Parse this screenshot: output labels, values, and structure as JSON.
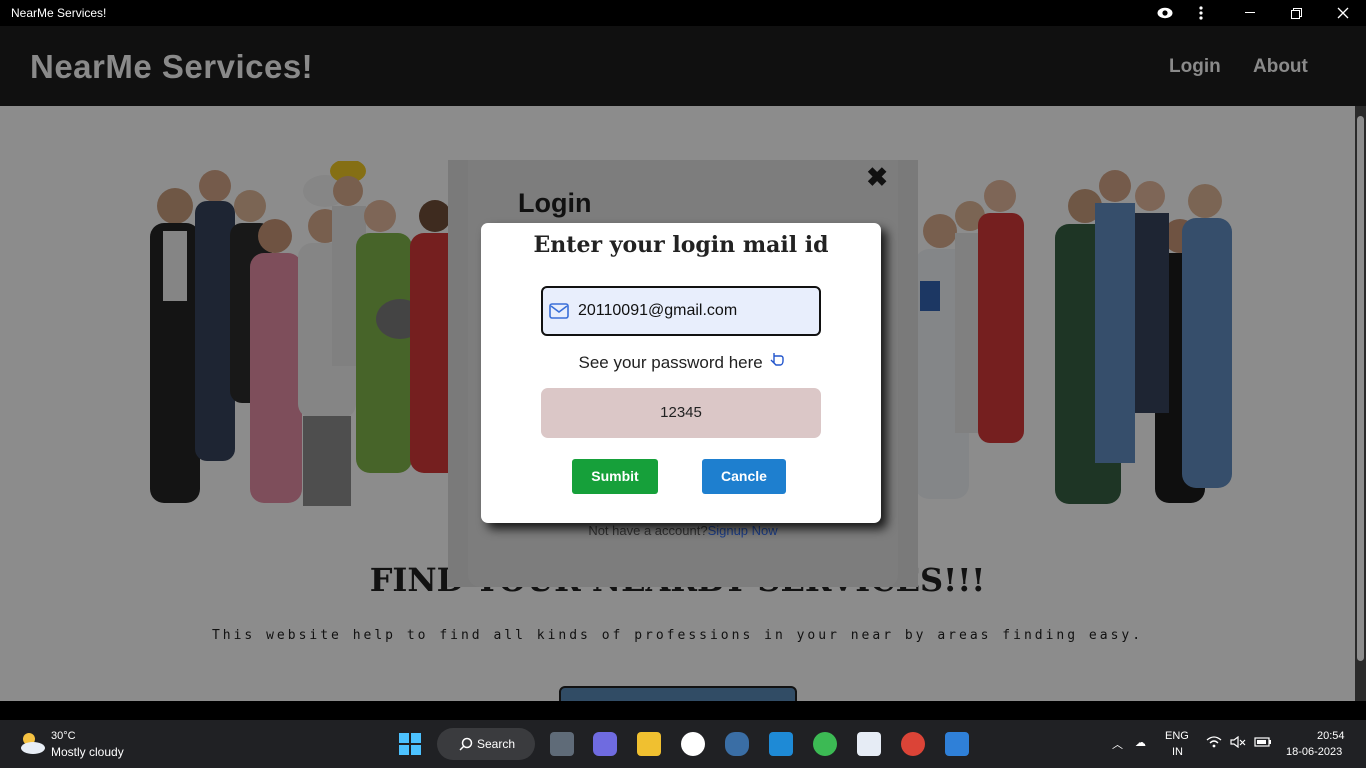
{
  "window": {
    "title": "NearMe Services!"
  },
  "navbar": {
    "brand": "NearMe Services!",
    "login": "Login",
    "about": "About"
  },
  "hero": {
    "title": "FIND YOUR NEARBY SERVICES!!!",
    "subtitle": "This website help to find all kinds of professions in your near by areas finding easy."
  },
  "back_modal": {
    "heading": "Login",
    "signup_text": "Not have a account?",
    "signup_link": "Signup Now"
  },
  "dialog": {
    "heading": "Enter your login mail id",
    "email_value": "20110091@gmail.com",
    "see_password": "See your password here",
    "password_value": "12345",
    "submit_label": "Sumbit",
    "cancel_label": "Cancle"
  },
  "taskbar": {
    "temperature": "30°C",
    "condition": "Mostly cloudy",
    "search_label": "Search",
    "lang_top": "ENG",
    "lang_bottom": "IN",
    "time": "20:54",
    "date": "18-06-2023"
  },
  "colors": {
    "submit": "#16a03a",
    "cancel": "#1e7fcf",
    "password_bg": "#dbc7c7",
    "email_bg": "#e8eefc"
  }
}
